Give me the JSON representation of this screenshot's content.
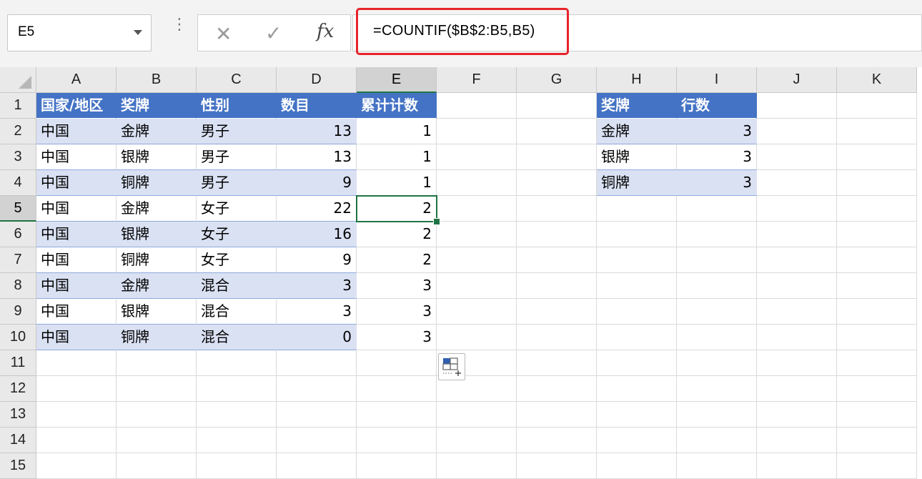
{
  "name_box": {
    "value": "E5"
  },
  "formula_bar": {
    "formula": "=COUNTIF($B$2:B5,B5)"
  },
  "icons": {
    "cancel": "✕",
    "enter": "✓",
    "fx": "fx",
    "separator": "⋮"
  },
  "columns": [
    "A",
    "B",
    "C",
    "D",
    "E",
    "F",
    "G",
    "H",
    "I",
    "J",
    "K"
  ],
  "selected_column": "E",
  "rows": [
    "1",
    "2",
    "3",
    "4",
    "5",
    "6",
    "7",
    "8",
    "9",
    "10",
    "11",
    "12",
    "13",
    "14",
    "15"
  ],
  "selected_row": "5",
  "table1": {
    "headers": [
      "国家/地区",
      "奖牌",
      "性别",
      "数目"
    ],
    "rows": [
      [
        "中国",
        "金牌",
        "男子",
        "13"
      ],
      [
        "中国",
        "银牌",
        "男子",
        "13"
      ],
      [
        "中国",
        "铜牌",
        "男子",
        "9"
      ],
      [
        "中国",
        "金牌",
        "女子",
        "22"
      ],
      [
        "中国",
        "银牌",
        "女子",
        "16"
      ],
      [
        "中国",
        "铜牌",
        "女子",
        "9"
      ],
      [
        "中国",
        "金牌",
        "混合",
        "3"
      ],
      [
        "中国",
        "银牌",
        "混合",
        "3"
      ],
      [
        "中国",
        "铜牌",
        "混合",
        "0"
      ]
    ]
  },
  "col_e": {
    "header": "累计计数",
    "values": [
      "1",
      "1",
      "1",
      "2",
      "2",
      "2",
      "3",
      "3",
      "3"
    ]
  },
  "table2": {
    "headers": [
      "奖牌",
      "行数"
    ],
    "rows": [
      [
        "金牌",
        "3"
      ],
      [
        "银牌",
        "3"
      ],
      [
        "铜牌",
        "3"
      ]
    ]
  },
  "colors": {
    "table_header": "#4472c4",
    "band": "#d9e1f2",
    "selection": "#217346",
    "highlight": "#e8242a"
  }
}
